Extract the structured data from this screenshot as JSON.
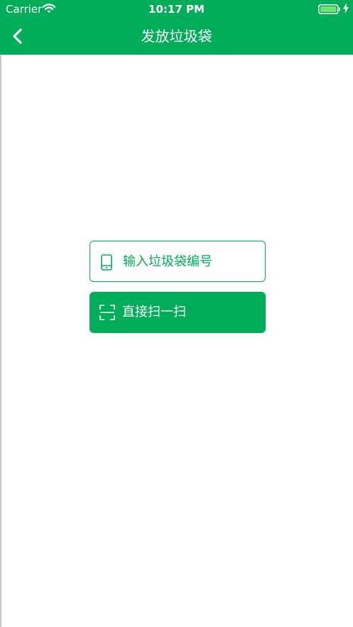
{
  "status_bar": {
    "carrier": "Carrier",
    "time": "10:17 PM",
    "wifi_icon": "wifi-icon",
    "battery_icon": "battery-full-icon",
    "charging_icon": "charging-bolt-icon"
  },
  "nav": {
    "title": "发放垃圾袋",
    "back_icon": "chevron-left-icon"
  },
  "actions": {
    "input_label": "输入垃圾袋编号",
    "input_icon": "phone-icon",
    "scan_label": "直接扫一扫",
    "scan_icon": "scan-frame-icon"
  },
  "colors": {
    "brand_green": "#00ad58",
    "background": "#ffffff",
    "text_on_brand": "#ffffff"
  }
}
